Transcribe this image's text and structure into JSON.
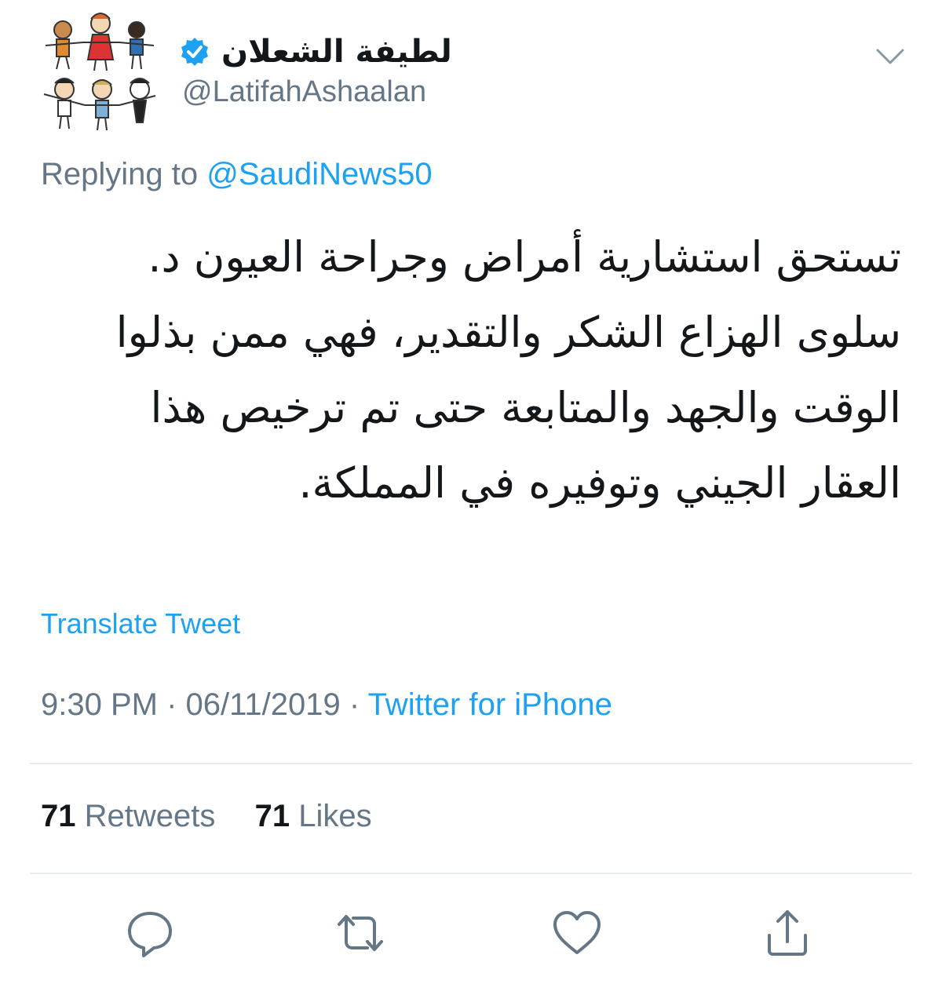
{
  "header": {
    "display_name": "لطيفة الشعلان",
    "handle": "@LatifahAshaalan",
    "avatar_icon": "children-drawing-avatar-icon",
    "verified_icon": "verified-badge-icon",
    "menu_icon": "chevron-down-icon"
  },
  "reply": {
    "prefix": "Replying to",
    "mention": "@SaudiNews50"
  },
  "tweet": {
    "lines": [
      "تستحق استشارية أمراض وجراحة العيون  د.",
      "سلوى الهزاع الشكر والتقدير، فهي ممن بذلوا",
      "الوقت والجهد والمتابعة حتى تم ترخيص هذا",
      "العقار الجيني وتوفيره في المملكة."
    ],
    "translate_label": "Translate Tweet"
  },
  "meta": {
    "time": "9:30 PM",
    "separator1": " · ",
    "date": "06/11/2019",
    "separator2": " · ",
    "source": "Twitter for iPhone"
  },
  "stats": {
    "retweets_count": "71",
    "retweets_label": "Retweets",
    "likes_count": "71",
    "likes_label": "Likes"
  },
  "actions": [
    {
      "name": "reply-icon"
    },
    {
      "name": "retweet-icon"
    },
    {
      "name": "like-icon"
    },
    {
      "name": "share-icon"
    }
  ],
  "colors": {
    "accent": "#1da1f2",
    "secondary_text": "#657786",
    "primary_text": "#14171a",
    "divider": "#e6ecf0"
  }
}
